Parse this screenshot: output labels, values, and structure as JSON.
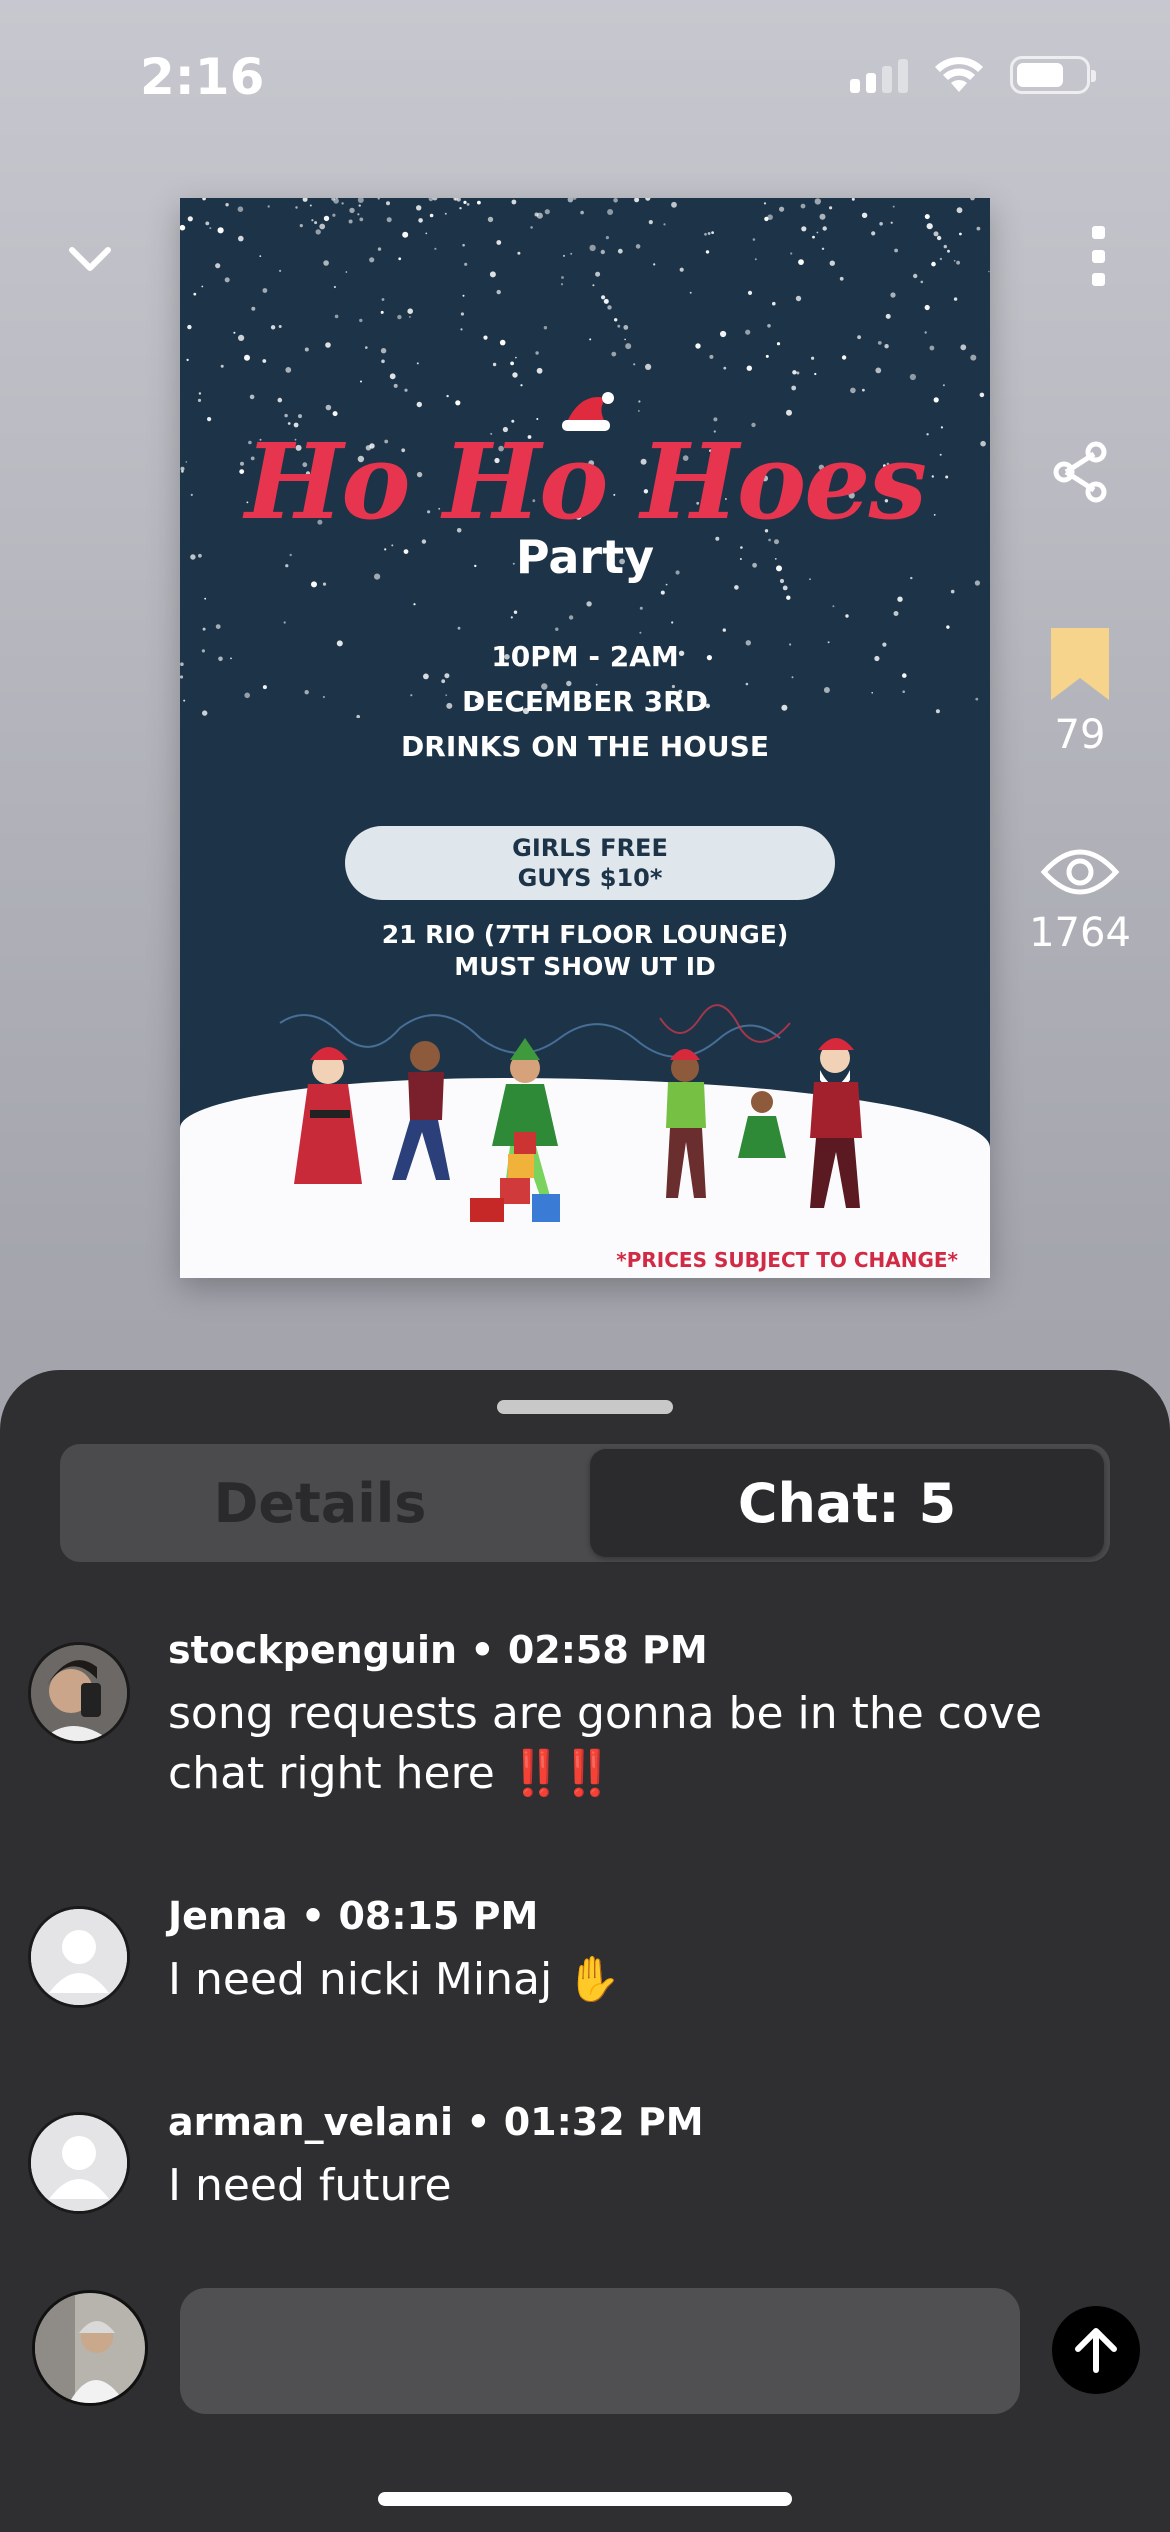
{
  "status_bar": {
    "time": "2:16"
  },
  "nav": {
    "collapse_icon": "chevron-down-icon",
    "more_icon": "kebab-menu-icon"
  },
  "flyer": {
    "title": "Ho Ho Hoes",
    "subtitle": "Party",
    "lines": [
      "10PM - 2AM",
      "DECEMBER 3RD",
      "DRINKS ON THE HOUSE"
    ],
    "pill_lines": [
      "GIRLS FREE",
      "GUYS $10*"
    ],
    "address_lines": [
      "21 RIO (7TH FLOOR LOUNGE)",
      "MUST SHOW UT ID"
    ],
    "note": "*PRICES SUBJECT TO CHANGE*",
    "colors": {
      "background": "#1d3448",
      "title": "#e8354f"
    }
  },
  "rail": {
    "share_icon": "share-icon",
    "bookmark": {
      "icon": "bookmark-icon",
      "count": "79",
      "color": "#f7d48c"
    },
    "views": {
      "icon": "eye-icon",
      "count": "1764"
    }
  },
  "tabs": {
    "details": "Details",
    "chat": "Chat: 5",
    "selected": "chat"
  },
  "messages": [
    {
      "user": "stockpenguin",
      "time": "02:58 PM",
      "text": "song requests are gonna be in the cove chat right here",
      "emoji": "‼️‼️"
    },
    {
      "user": "Jenna",
      "time": "08:15 PM",
      "text": "I need nicki Minaj",
      "emoji": "✋"
    },
    {
      "user": "arman_velani",
      "time": "01:32 PM",
      "text": "I need future"
    }
  ],
  "composer": {
    "placeholder": "",
    "send_icon": "arrow-up-icon"
  },
  "separator": "•"
}
